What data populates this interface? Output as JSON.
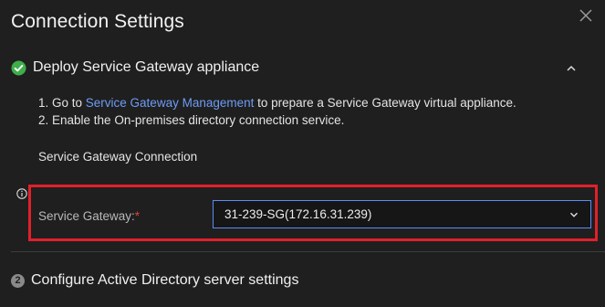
{
  "dialog": {
    "title": "Connection Settings"
  },
  "step1": {
    "title": "Deploy Service Gateway appliance",
    "status": "completed",
    "instruction1_prefix": "1. Go to ",
    "instruction1_link": "Service Gateway Management",
    "instruction1_suffix": " to prepare a Service Gateway virtual appliance.",
    "instruction2": "2. Enable the On-premises directory connection service.",
    "section_label": "Service Gateway Connection",
    "gateway_field": {
      "label": "Service Gateway:",
      "required_marker": "*",
      "selected_value": "31-239-SG(172.16.31.239)"
    }
  },
  "step2": {
    "number": "2",
    "title": "Configure Active Directory server settings"
  },
  "colors": {
    "background": "#1f1f1f",
    "link": "#6e9cf5",
    "success": "#3fae4a",
    "highlight": "#e0202a",
    "focus_border": "#5a8df5"
  },
  "icons": {
    "close": "close-icon",
    "check": "check-circle-icon",
    "collapse": "chevron-up-icon",
    "info": "info-icon",
    "dropdown": "chevron-down-icon"
  }
}
